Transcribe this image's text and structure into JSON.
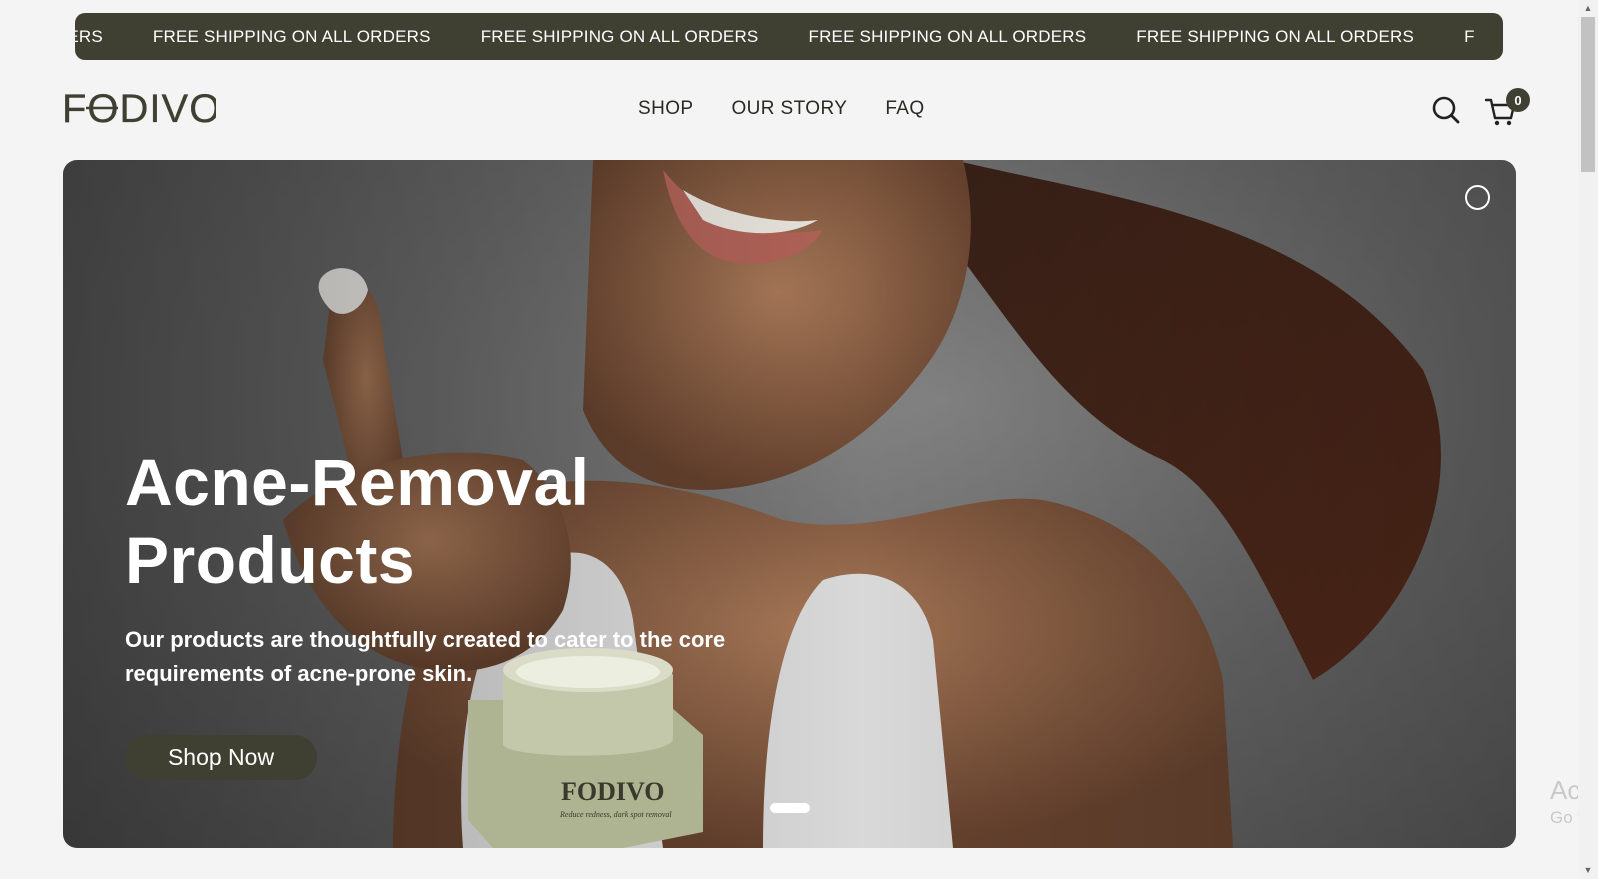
{
  "announcement": {
    "items": [
      "L ORDERS",
      "FREE SHIPPING ON ALL ORDERS",
      "FREE SHIPPING ON ALL ORDERS",
      "FREE SHIPPING ON ALL ORDERS",
      "FREE SHIPPING ON ALL ORDERS",
      "F"
    ]
  },
  "header": {
    "logo_text": "FODIVO",
    "nav": [
      "SHOP",
      "OUR STORY",
      "FAQ"
    ],
    "cart_count": "0"
  },
  "hero": {
    "title_line1": "Acne-Removal",
    "title_line2": "Products",
    "subtitle": "Our products are thoughtfully created to cater to the core requirements of acne-prone skin.",
    "cta": "Shop Now",
    "jar_brand": "FODIVO",
    "jar_tagline": "Reduce redness, dark spot removal"
  },
  "watermark": {
    "line1": "Activ",
    "line2": "Go to"
  },
  "colors": {
    "accent": "#3f3f32",
    "jar": "#b5bb98",
    "background": "#f4f4f4"
  }
}
